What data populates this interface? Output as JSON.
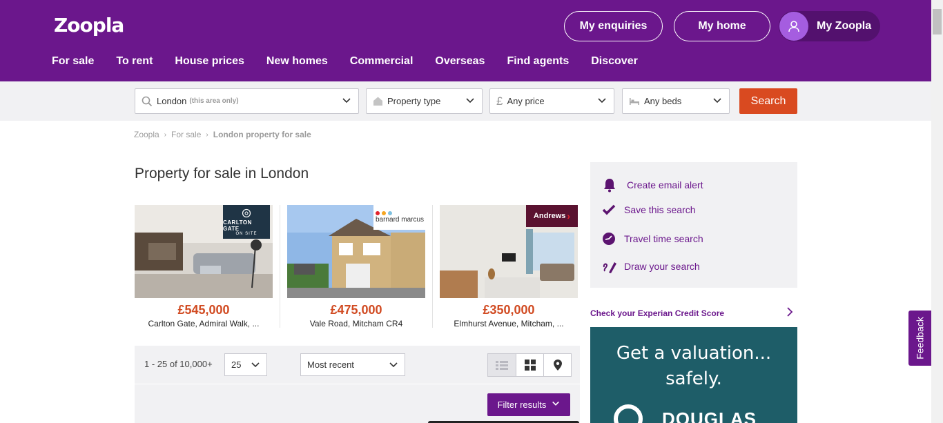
{
  "brand": {
    "logo_text": "Zoopla",
    "primary_color": "#6b178c",
    "accent_color": "#d94a20"
  },
  "header": {
    "enquiries_label": "My enquiries",
    "home_label": "My home",
    "myzoopla_label": "My Zoopla",
    "nav": [
      "For sale",
      "To rent",
      "House prices",
      "New homes",
      "Commercial",
      "Overseas",
      "Find agents",
      "Discover"
    ]
  },
  "search": {
    "location": "London",
    "location_hint": "(this area only)",
    "property_type": "Property type",
    "price": "Any price",
    "beds": "Any beds",
    "button_label": "Search"
  },
  "breadcrumb": [
    "Zoopla",
    "For sale",
    "London property for sale"
  ],
  "page_title": "Property for sale in London",
  "featured": [
    {
      "price": "£545,000",
      "address": "Carlton Gate, Admiral Walk, ...",
      "agent": "CARLTON GATE",
      "agent_sub": "ON SITE"
    },
    {
      "price": "£475,000",
      "address": "Vale Road, Mitcham CR4",
      "agent": "barnard marcus",
      "agent_sub": ""
    },
    {
      "price": "£350,000",
      "address": "Elmhurst Avenue, Mitcham, ...",
      "agent": "Andrews",
      "agent_sub": ""
    }
  ],
  "results": {
    "count": "1 - 25 of 10,000+",
    "per_page": "25",
    "sort": "Most recent",
    "filter_label": "Filter results"
  },
  "sidebar": {
    "actions": [
      "Create email alert",
      "Save this search",
      "Travel time search",
      "Draw your search"
    ],
    "experian_link": "Check your Experian Credit Score",
    "ad_line1": "Get a valuation...",
    "ad_line2": "safely.",
    "ad_brand": "DOUGLAS"
  },
  "feedback_label": "Feedback",
  "icons": [
    "search-icon",
    "chevron-down-icon",
    "house-icon",
    "pound-icon",
    "bed-icon",
    "user-icon",
    "bell-icon",
    "check-icon",
    "clock-icon",
    "draw-icon",
    "list-view-icon",
    "grid-view-icon",
    "map-pin-icon",
    "chevron-right-icon"
  ]
}
